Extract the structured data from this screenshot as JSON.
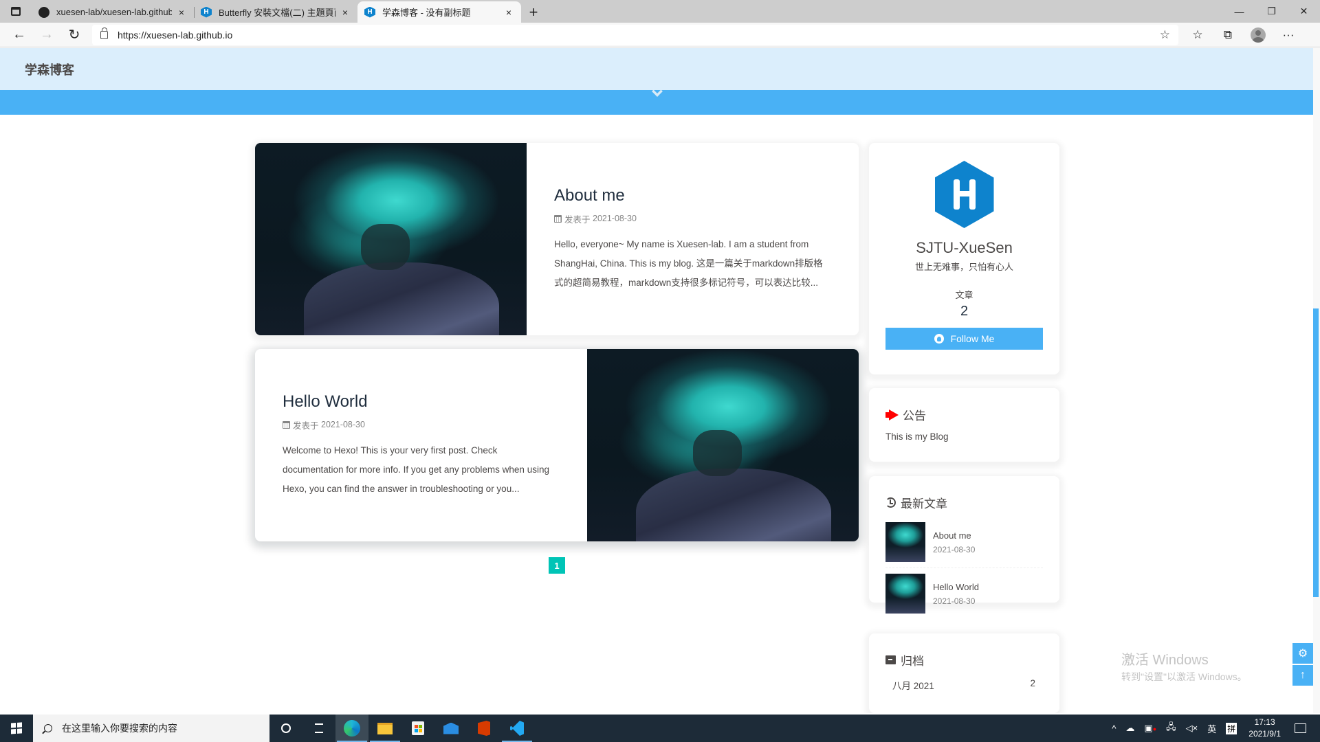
{
  "browser": {
    "tabs": [
      {
        "label": "xuesen-lab/xuesen-lab.github.io",
        "icon": "github-icon",
        "active": false
      },
      {
        "label": "Butterfly 安裝文檔(二) 主題頁面",
        "icon": "hexo-icon",
        "active": false
      },
      {
        "label": "学森博客 - 没有副标题",
        "icon": "hexo-icon",
        "active": true
      }
    ],
    "new_tab_label": "+",
    "close_glyph": "×",
    "url": "https://xuesen-lab.github.io",
    "window_controls": {
      "minimize": "—",
      "restore": "❐",
      "close": "✕"
    }
  },
  "site": {
    "title": "学森博客",
    "accent_color": "#49b1f5",
    "nav_bg": "#dbeefc"
  },
  "posts": [
    {
      "title": "About me",
      "meta_label": "发表于",
      "date": "2021-08-30",
      "excerpt": "Hello, everyone~ My name is Xuesen-lab. I am a student from ShangHai, China. This is my blog. 这是一篇关于markdown排版格式的超简易教程，markdown支持很多标记符号，可以表达比较..."
    },
    {
      "title": "Hello World",
      "meta_label": "发表于",
      "date": "2021-08-30",
      "excerpt": "Welcome to Hexo! This is your very first post. Check documentation for more info. If you get any problems when using Hexo, you can find the answer in troubleshooting or you..."
    }
  ],
  "pagination": {
    "current": "1"
  },
  "author": {
    "name": "SJTU-XueSen",
    "description": "世上无难事，只怕有心人",
    "stat_label": "文章",
    "stat_value": "2",
    "follow_label": "Follow Me"
  },
  "announcement": {
    "title": "公告",
    "text": "This is my Blog",
    "icon_color": "#ff0000"
  },
  "recent_posts": {
    "title": "最新文章",
    "items": [
      {
        "title": "About me",
        "date": "2021-08-30"
      },
      {
        "title": "Hello World",
        "date": "2021-08-30"
      }
    ]
  },
  "archives": {
    "title": "归档",
    "items": [
      {
        "label": "八月 2021",
        "count": "2"
      }
    ]
  },
  "watermark": {
    "line1": "激活 Windows",
    "line2": "转到\"设置\"以激活 Windows。"
  },
  "rightside": {
    "settings": "⚙",
    "to_top": "↑"
  },
  "taskbar": {
    "search_placeholder": "在这里输入你要搜索的内容",
    "tray": {
      "chevron": "^",
      "volume": "🔇",
      "ime_lang": "英",
      "ime_mode": "拼",
      "time": "17:13",
      "date": "2021/9/1"
    }
  }
}
